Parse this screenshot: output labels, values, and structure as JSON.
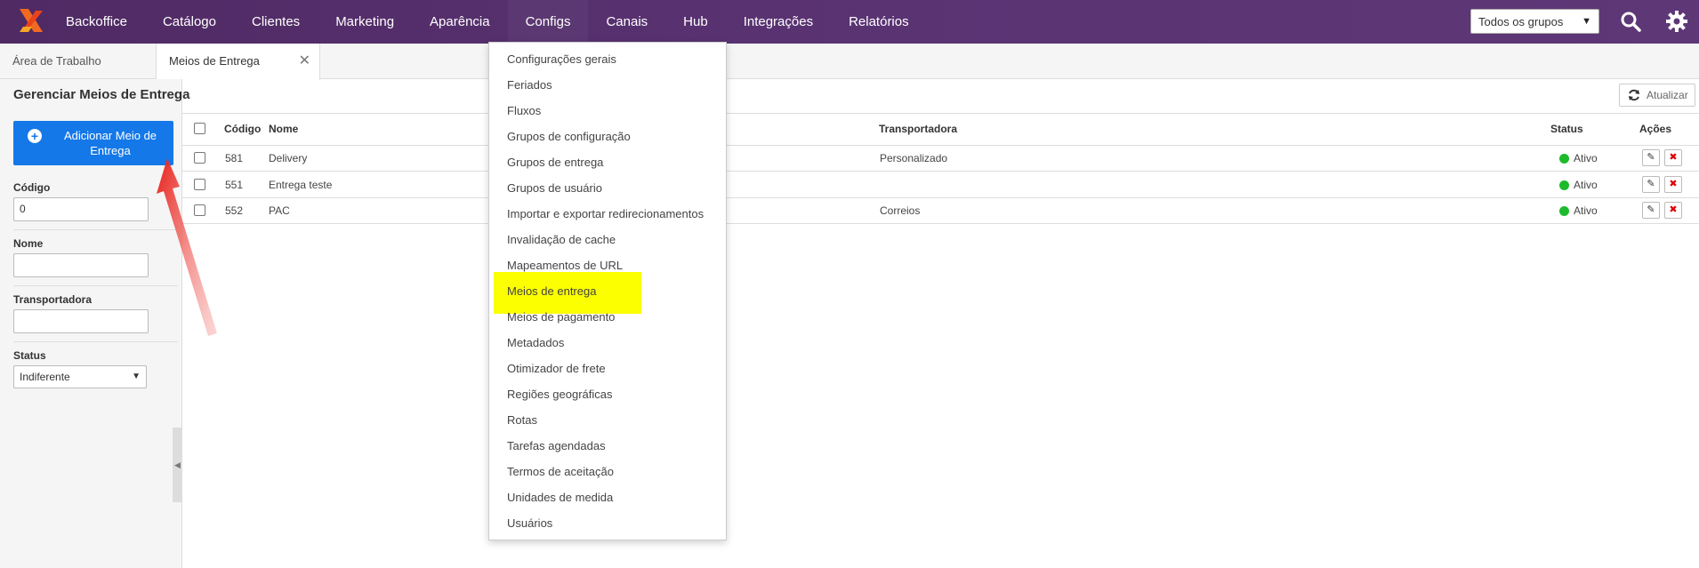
{
  "nav": {
    "items": [
      "Backoffice",
      "Catálogo",
      "Clientes",
      "Marketing",
      "Aparência",
      "Configs",
      "Canais",
      "Hub",
      "Integrações",
      "Relatórios"
    ],
    "active": "Configs",
    "group_select": "Todos os grupos",
    "search_icon": "search-icon",
    "settings_icon": "gear-icon"
  },
  "tabs": {
    "workspace": "Área de Trabalho",
    "current": "Meios de Entrega"
  },
  "sidebar": {
    "title": "Gerenciar Meios de Entrega",
    "add_button": "Adicionar Meio de Entrega",
    "code_label": "Código",
    "code_value": "0",
    "name_label": "Nome",
    "name_value": "",
    "carrier_label": "Transportadora",
    "carrier_value": "",
    "status_label": "Status",
    "status_value": "Indiferente"
  },
  "toolbar": {
    "refresh": "Atualizar"
  },
  "table": {
    "headers": {
      "code": "Código",
      "name": "Nome",
      "carrier": "Transportadora",
      "status": "Status",
      "actions": "Ações"
    },
    "rows": [
      {
        "code": "581",
        "name": "Delivery",
        "carrier": "Personalizado",
        "status": "Ativo"
      },
      {
        "code": "551",
        "name": "Entrega teste",
        "carrier": "",
        "status": "Ativo"
      },
      {
        "code": "552",
        "name": "PAC",
        "carrier": "Correios",
        "status": "Ativo"
      }
    ]
  },
  "dropdown": {
    "items": [
      "Configurações gerais",
      "Feriados",
      "Fluxos",
      "Grupos de configuração",
      "Grupos de entrega",
      "Grupos de usuário",
      "Importar e exportar redirecionamentos",
      "Invalidação de cache",
      "Mapeamentos de URL",
      "Meios de entrega",
      "Meios de pagamento",
      "Metadados",
      "Otimizador de frete",
      "Regiões geográficas",
      "Rotas",
      "Tarefas agendadas",
      "Termos de aceitação",
      "Unidades de medida",
      "Usuários"
    ],
    "highlighted": "Meios de entrega",
    "highlight_color": "#fbff00"
  },
  "colors": {
    "nav": "#5a3373",
    "primary": "#1478e8",
    "active_dot": "#1dbb2c",
    "annotation_arrow": "#e8201a"
  }
}
